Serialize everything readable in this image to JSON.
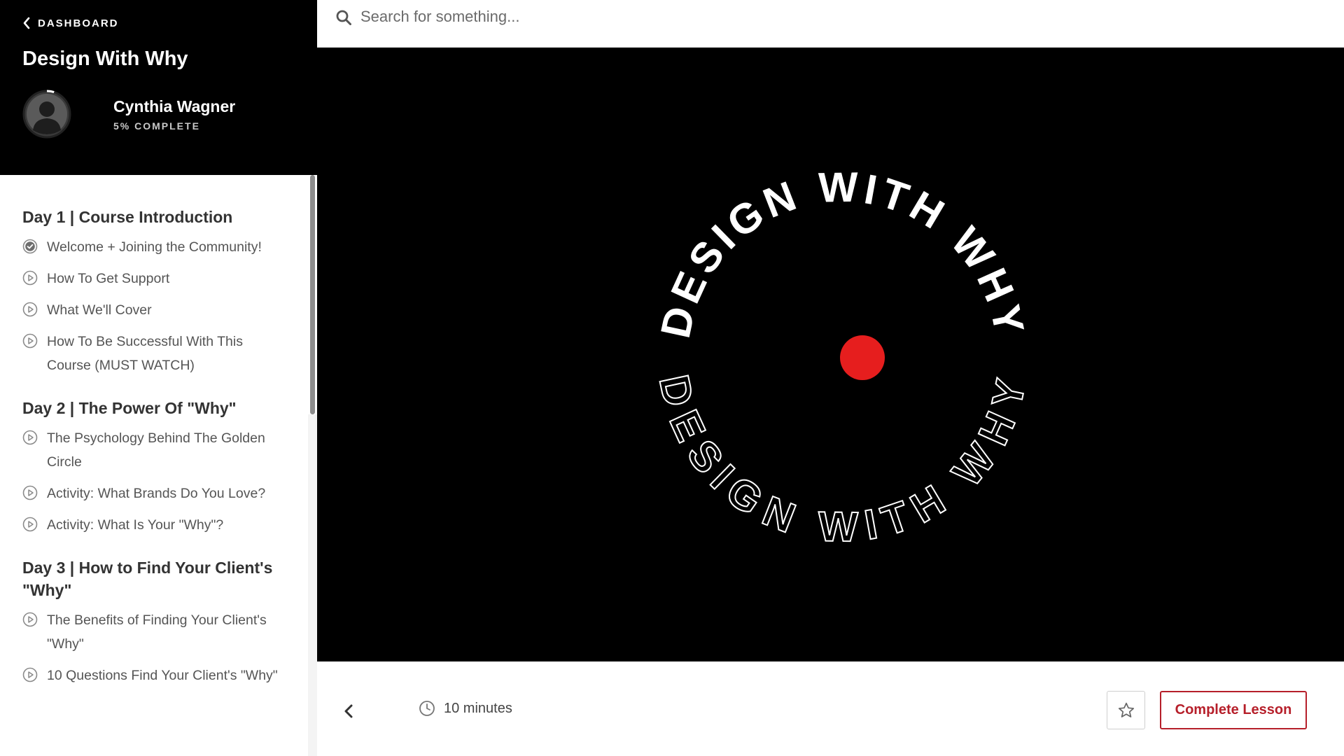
{
  "sidebar": {
    "back_label": "DASHBOARD",
    "course_title": "Design With Why",
    "user_name": "Cynthia Wagner",
    "progress_text": "5% COMPLETE",
    "progress_fraction": 0.05,
    "sections": [
      {
        "title": "Day 1 | Course Introduction",
        "lessons": [
          {
            "label": "Welcome + Joining the Community!",
            "icon": "check-circle-icon",
            "completed": true
          },
          {
            "label": "How To Get Support",
            "icon": "play-circle-icon",
            "completed": false
          },
          {
            "label": "What We'll Cover",
            "icon": "play-circle-icon",
            "completed": false
          },
          {
            "label": "How To Be Successful With This Course (MUST WATCH)",
            "icon": "play-circle-icon",
            "completed": false
          }
        ]
      },
      {
        "title": "Day 2 | The Power Of \"Why\"",
        "lessons": [
          {
            "label": "The Psychology Behind The Golden Circle",
            "icon": "play-circle-icon",
            "completed": false
          },
          {
            "label": "Activity: What Brands Do You Love?",
            "icon": "play-circle-icon",
            "completed": false
          },
          {
            "label": "Activity: What Is Your \"Why\"?",
            "icon": "play-circle-icon",
            "completed": false
          }
        ]
      },
      {
        "title": "Day 3 | How to Find Your Client's \"Why\"",
        "lessons": [
          {
            "label": "The Benefits of Finding Your Client's \"Why\"",
            "icon": "play-circle-icon",
            "completed": false
          },
          {
            "label": "10 Questions Find Your Client's \"Why\"",
            "icon": "play-circle-icon",
            "completed": false
          }
        ]
      }
    ]
  },
  "search": {
    "placeholder": "Search for something..."
  },
  "video": {
    "text_top": "DESIGN WITH WHY",
    "text_bottom": "DESIGN WITH WHY",
    "dot_color": "#e61e1e"
  },
  "bottombar": {
    "duration": "10 minutes",
    "complete_label": "Complete Lesson"
  },
  "colors": {
    "accent": "#b61f2a",
    "sidebar_header_bg": "#000000",
    "video_bg": "#000000"
  }
}
